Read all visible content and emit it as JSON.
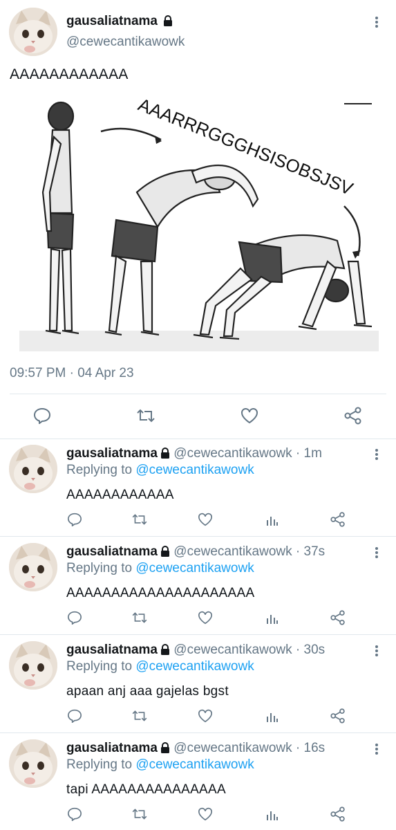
{
  "main_tweet": {
    "display_name": "gausaliatnama",
    "handle": "@cewecantikawowk",
    "text": "AAAAAAAAAAAA",
    "image_caption": "AAARRRGGGHSISOBSJSV",
    "timestamp": "09:57 PM · 04 Apr 23",
    "icons": [
      "reply-icon",
      "retweet-icon",
      "like-icon",
      "share-icon"
    ]
  },
  "replies": [
    {
      "display_name": "gausaliatnama",
      "handle": "@cewecantikawowk",
      "time": "· 1m",
      "replying_label": "Replying to",
      "replying_to": "@cewecantikawowk",
      "text": "AAAAAAAAAAAA"
    },
    {
      "display_name": "gausaliatnama",
      "handle": "@cewecantikawowk",
      "time": "· 37s",
      "replying_label": "Replying to",
      "replying_to": "@cewecantikawowk",
      "text": "AAAAAAAAAAAAAAAAAAAAA"
    },
    {
      "display_name": "gausaliatnama",
      "handle": "@cewecantikawowk",
      "time": "· 30s",
      "replying_label": "Replying to",
      "replying_to": "@cewecantikawowk",
      "text": "apaan anj aaa gajelas bgst"
    },
    {
      "display_name": "gausaliatnama",
      "handle": "@cewecantikawowk",
      "time": "· 16s",
      "replying_label": "Replying to",
      "replying_to": "@cewecantikawowk",
      "text": "tapi AAAAAAAAAAAAAAA"
    }
  ],
  "colors": {
    "link": "#1da1f2",
    "secondary": "#657786",
    "border": "#e1e8ed"
  }
}
